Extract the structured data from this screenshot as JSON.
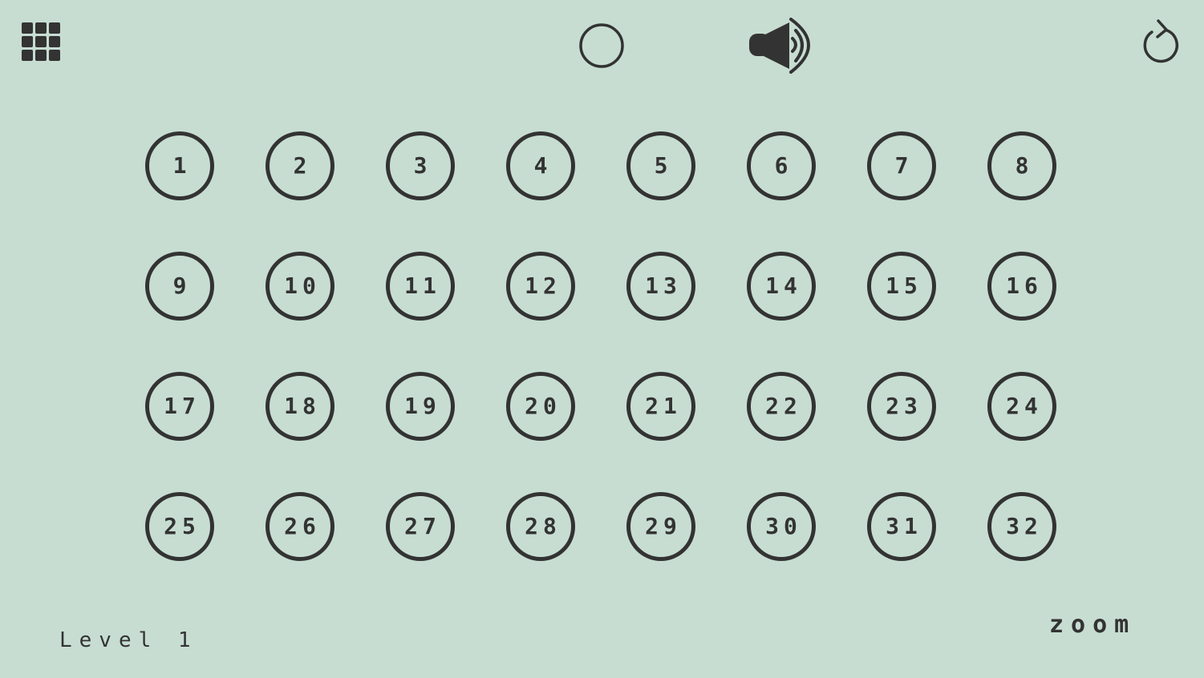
{
  "toolbar": {
    "menu_icon": "grid-menu-icon",
    "circle_icon": "circle-icon",
    "sound_icon": "speaker-sound-icon",
    "restart_icon": "restart-icon"
  },
  "levels": [
    "1",
    "2",
    "3",
    "4",
    "5",
    "6",
    "7",
    "8",
    "9",
    "10",
    "11",
    "12",
    "13",
    "14",
    "15",
    "16",
    "17",
    "18",
    "19",
    "20",
    "21",
    "22",
    "23",
    "24",
    "25",
    "26",
    "27",
    "28",
    "29",
    "30",
    "31",
    "32"
  ],
  "footer": {
    "level_label": "Level 1",
    "zoom_label": "zoom"
  },
  "colors": {
    "background": "#c7ddd2",
    "foreground": "#333333"
  }
}
